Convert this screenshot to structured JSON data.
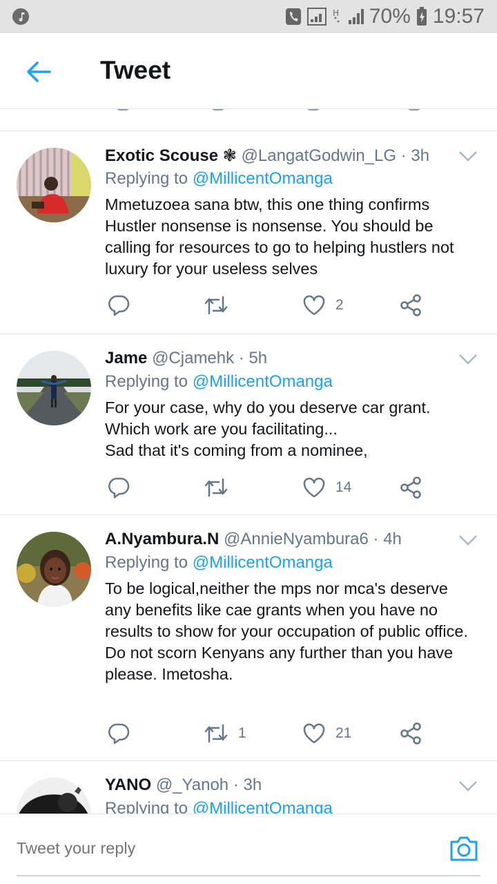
{
  "status_bar": {
    "battery": "70%",
    "time": "19:57",
    "colors": {
      "bg": "#e3e3e3",
      "icon": "#666666"
    }
  },
  "header": {
    "title": "Tweet",
    "back_icon": "arrow-left-icon"
  },
  "theme": {
    "accent": "#1da1f2",
    "muted": "#657786",
    "text": "#14171a",
    "border": "#e1e8ed"
  },
  "tweets": [
    {
      "name": "Exotic Scouse",
      "badge": "❃",
      "handle": "@LangatGodwin_LG",
      "time": "· 3h",
      "replying_label": "Replying to",
      "replying_to": "@MillicentOmanga",
      "text": "Mmetuzoea sana btw, this one thing confirms Hustler nonsense is nonsense. You should be calling for resources to go to helping hustlers not luxury for your useless selves",
      "retweets": "",
      "likes": "2"
    },
    {
      "name": "Jame",
      "handle": "@Cjamehk",
      "time": "· 5h",
      "replying_label": "Replying to",
      "replying_to": "@MillicentOmanga",
      "text": "For your case, why do you deserve car grant.\nWhich work are you facilitating...\nSad that it's coming from a nominee,",
      "retweets": "",
      "likes": "14"
    },
    {
      "name": "A.Nyambura.N",
      "handle": "@AnnieNyambura6",
      "time": "· 4h",
      "replying_label": "Replying to",
      "replying_to": "@MillicentOmanga",
      "text": "To be logical,neither the mps nor mca's deserve any benefits like cae grants when you have no results to show for your occupation of public office.\nDo not scorn Kenyans any further than you have please. Imetosha.",
      "retweets": "1",
      "likes": "21"
    },
    {
      "name": "YANO",
      "handle": "@_Yanoh",
      "time": "· 3h",
      "replying_label": "Replying to",
      "replying_to": "@MillicentOmanga"
    }
  ],
  "composer": {
    "placeholder": "Tweet your reply",
    "camera_icon": "camera-icon"
  }
}
